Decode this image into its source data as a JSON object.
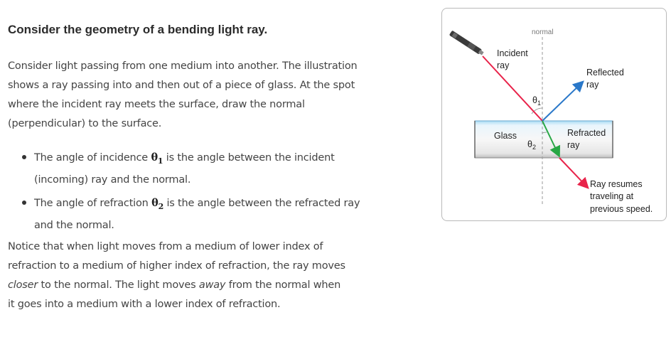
{
  "heading": "Consider the geometry of a bending light ray.",
  "intro": "Consider light passing from one medium into another. The illustration shows a ray passing into and then out of a piece of glass. At the spot where the incident ray meets the surface, draw the normal (perpendicular) to the surface.",
  "bullets": [
    {
      "before": "The angle of incidence ",
      "symbol": "θ",
      "sub": "1",
      "after": " is the angle between the incident (incoming) ray and the normal."
    },
    {
      "before": "The angle of refraction ",
      "symbol": "θ",
      "sub": "2",
      "after": " is the angle between the refracted ray and the normal."
    }
  ],
  "notice": {
    "part1": "Notice that when light moves from a medium of lower index of refraction to a medium of higher index of refraction, the ray moves ",
    "em1": "closer",
    "part2": " to the normal. The light moves ",
    "em2": "away",
    "part3": " from the normal when it goes into a medium with a lower index of refraction."
  },
  "diagram": {
    "normal_label": "normal",
    "incident_label": [
      "Incident",
      "ray"
    ],
    "reflected_label": [
      "Reflected",
      "ray"
    ],
    "refracted_label": [
      "Refracted",
      "ray"
    ],
    "glass_label": "Glass",
    "theta1_label": "θ",
    "theta1_sub": "1",
    "theta2_label": "θ",
    "theta2_sub": "2",
    "resume_label": [
      "Ray resumes",
      "traveling at",
      "previous speed."
    ],
    "colors": {
      "incident": "#e8234a",
      "reflected": "#2a78c9",
      "refracted": "#28a745",
      "glass_top": "#9fd4f0",
      "pointer": "#555555"
    },
    "icons": [
      "laser-pointer-icon"
    ]
  }
}
